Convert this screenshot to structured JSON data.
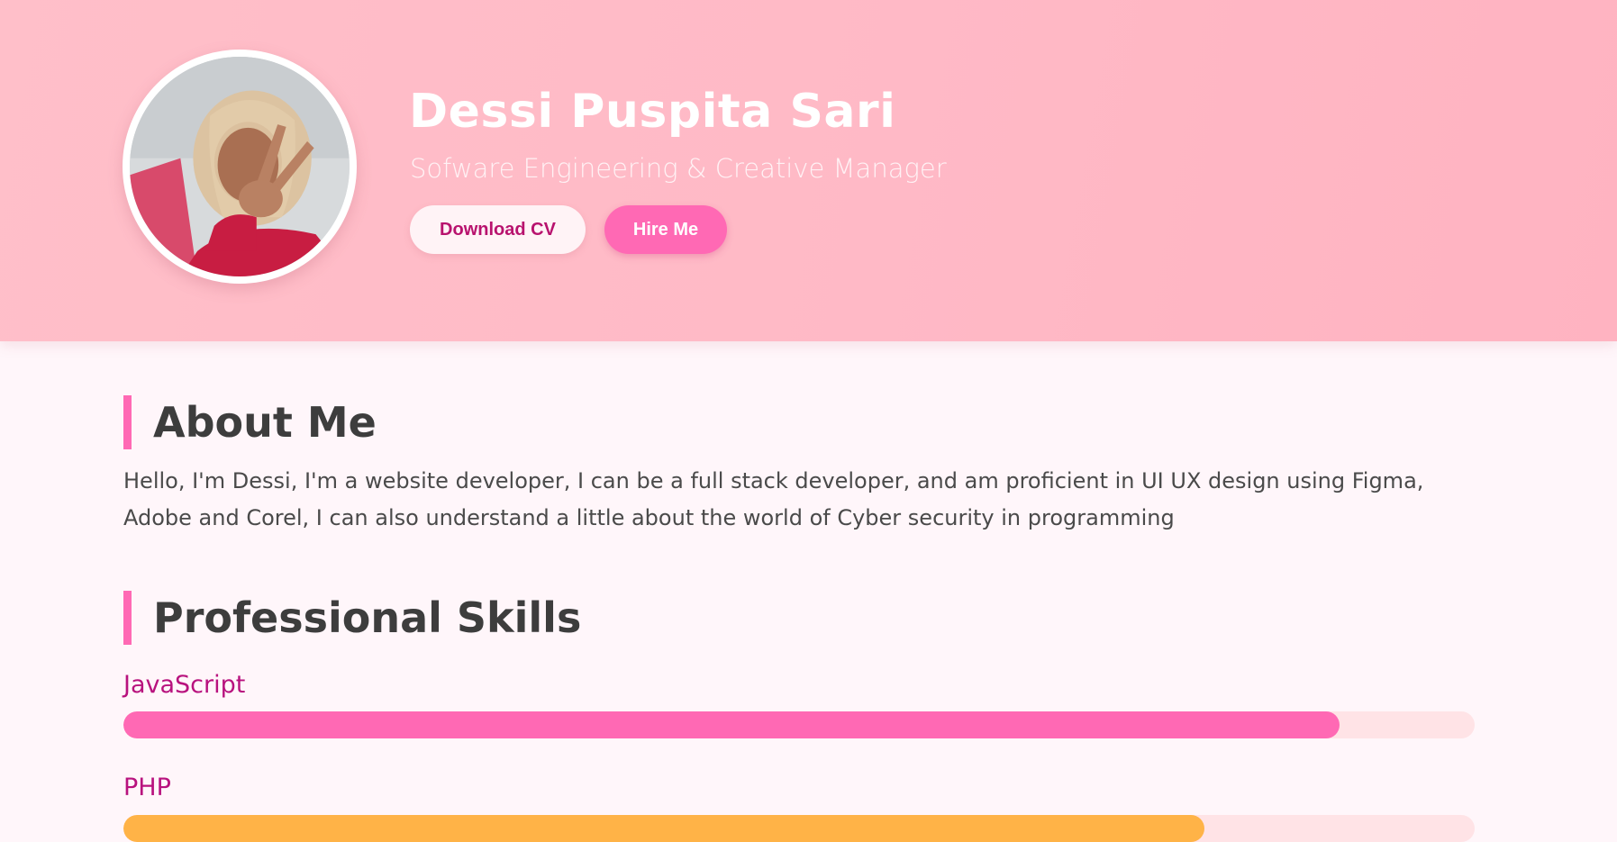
{
  "profile": {
    "name": "Dessi Puspita Sari",
    "subtitle": "Sofware Engineering & Creative Manager",
    "avatar_icon": "profile-photo"
  },
  "actions": {
    "download_label": "Download CV",
    "hire_label": "Hire Me"
  },
  "about": {
    "title": "About Me",
    "text": "Hello, I'm Dessi, I'm a website developer, I can be a full stack developer, and am proficient in UI UX design using Figma, Adobe and Corel, I can also understand a little about the world of Cyber security in programming"
  },
  "skills": {
    "title": "Professional Skills",
    "items": [
      {
        "name": "JavaScript",
        "level": 0.9,
        "color": "#ff69b4"
      },
      {
        "name": "PHP",
        "level": 0.8,
        "color": "#ffb347"
      }
    ]
  },
  "colors": {
    "accent": "#ff69b4",
    "hero_bg": "#ffb9c6",
    "skill_label": "#b8127e",
    "track": "#ffe3e6",
    "page_bg": "#fff6fa"
  }
}
